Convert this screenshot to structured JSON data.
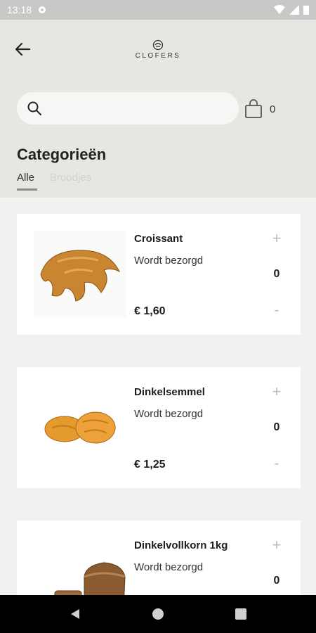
{
  "status_bar": {
    "time": "13:18"
  },
  "header": {
    "logo_text": "CLOFERS",
    "search": {
      "placeholder": "",
      "value": ""
    },
    "cart_count": "0"
  },
  "categories": {
    "title": "Categorieën",
    "tabs": [
      {
        "label": "Alle",
        "active": true
      },
      {
        "label": "Broodjes",
        "active": false
      }
    ]
  },
  "products": [
    {
      "name": "Croissant",
      "status": "Wordt bezorgd",
      "price": "€ 1,60",
      "quantity": "0",
      "plus": "+",
      "minus": "-",
      "image_icon": "croissant-image"
    },
    {
      "name": "Dinkelsemmel",
      "status": "Wordt bezorgd",
      "price": "€ 1,25",
      "quantity": "0",
      "plus": "+",
      "minus": "-",
      "image_icon": "bread-rolls-image"
    },
    {
      "name": "Dinkelvollkorn 1kg",
      "status": "Wordt bezorgd",
      "price": "",
      "quantity": "0",
      "plus": "+",
      "minus": "-",
      "image_icon": "bread-loaf-image"
    }
  ],
  "colors": {
    "header_bg": "#e8e6e3",
    "page_bg": "#f2f1f0",
    "card_bg": "#ffffff",
    "accent_underline": "#8e8c8a"
  }
}
